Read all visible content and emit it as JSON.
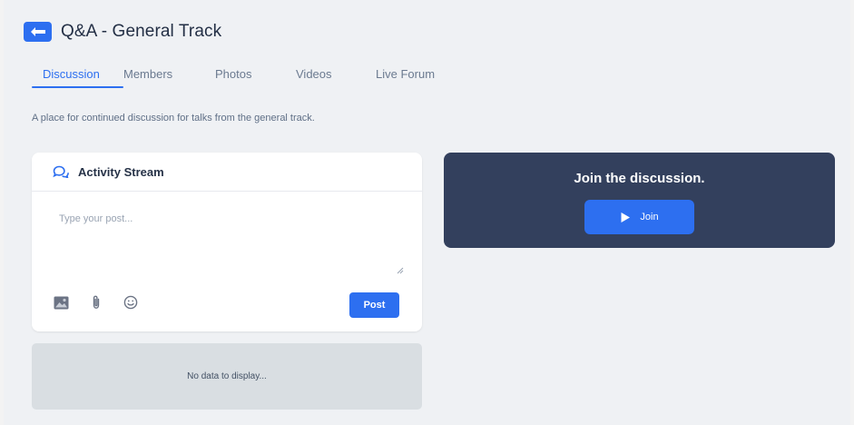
{
  "page": {
    "title": "Q&A - General Track",
    "description": "A place for continued discussion for talks from the general track."
  },
  "tabs": [
    {
      "label": "Discussion",
      "active": true
    },
    {
      "label": "Members",
      "active": false
    },
    {
      "label": "Photos",
      "active": false
    },
    {
      "label": "Videos",
      "active": false
    },
    {
      "label": "Live Forum",
      "active": false
    }
  ],
  "activity": {
    "title": "Activity Stream",
    "icon": "chat-bubbles-icon",
    "post_placeholder": "Type your post...",
    "post_button": "Post",
    "toolbar_icons": [
      "image-icon",
      "paperclip-icon",
      "emoji-icon"
    ]
  },
  "feed": {
    "empty_text": "No data to display..."
  },
  "join": {
    "title": "Join the discussion.",
    "button_label": "Join",
    "button_icon": "play-icon"
  },
  "colors": {
    "accent": "#2d6ff0",
    "join_card": "#33405d",
    "background": "#eff1f4",
    "empty_panel": "#d9dee2"
  }
}
